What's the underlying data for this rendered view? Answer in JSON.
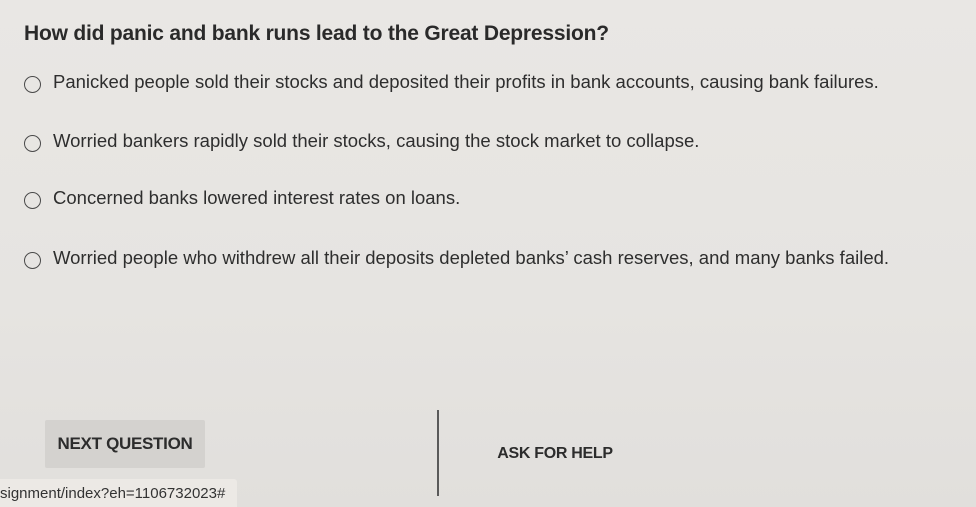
{
  "question": {
    "text": "How did panic and bank runs lead to the Great Depression?"
  },
  "options": [
    {
      "label": "Panicked people sold their stocks and deposited their profits in bank accounts, causing bank failures."
    },
    {
      "label": "Worried bankers rapidly sold their stocks, causing the stock market to collapse."
    },
    {
      "label": "Concerned banks lowered interest rates on loans."
    },
    {
      "label": "Worried people who withdrew all their deposits depleted banks’ cash reserves, and many banks failed."
    }
  ],
  "actions": {
    "next_label": "NEXT QUESTION",
    "help_label": "ASK FOR HELP"
  },
  "status_bar": {
    "url_text": "signment/index?eh=1106732023#"
  }
}
